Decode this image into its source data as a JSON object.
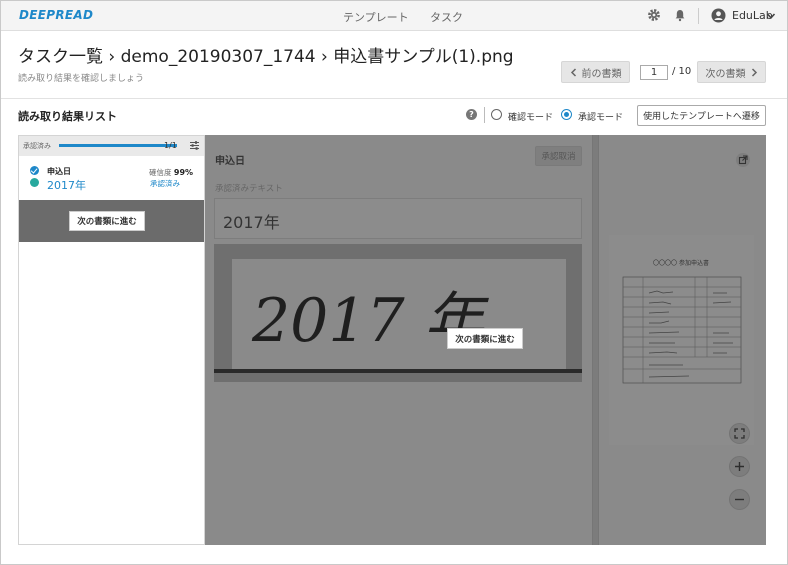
{
  "app": {
    "logo": "DEEPREAD",
    "nav": {
      "templates": "テンプレート",
      "tasks": "タスク"
    },
    "icons": {
      "settings": "gear-icon",
      "notifications": "bell-icon",
      "user": "user-avatar-icon",
      "dropdown": "chevron-down-icon"
    },
    "user_name": "EduLab"
  },
  "header": {
    "title": "タスク一覧 › demo_20190307_1744 › 申込書サンプル(1).png",
    "subtitle": "読み取り結果を確認しましょう",
    "prev_label": "前の書類",
    "next_label": "次の書類",
    "page_current": "1",
    "page_total": "/ 10"
  },
  "toolbar": {
    "list_title": "読み取り結果リスト",
    "help": "?",
    "mode_confirm": "確認モード",
    "mode_approve": "承認モード",
    "selected_mode": "approve",
    "template_button": "使用したテンプレートへ遷移"
  },
  "result_list": {
    "progress_label": "承認済み",
    "progress_fraction": 1.0,
    "progress_count": "1/1",
    "items": [
      {
        "label": "申込日",
        "value": "2017年",
        "confidence_label": "確信度",
        "confidence": "99%",
        "status": "承認済み"
      }
    ],
    "next_doc_button": "次の書類に進む"
  },
  "detail": {
    "field_title": "申込日",
    "unapprove_button": "承認取消",
    "approved_text_label": "承認済みテキスト",
    "value": "2017年",
    "handwriting": "2017 年",
    "next_doc_button": "次の書類に進む"
  },
  "thumbnail": {
    "title": "〇〇〇〇 参加申込書"
  },
  "colors": {
    "accent": "#1e88c9",
    "teal": "#28a99e",
    "overlay": "#8a8a8a"
  }
}
